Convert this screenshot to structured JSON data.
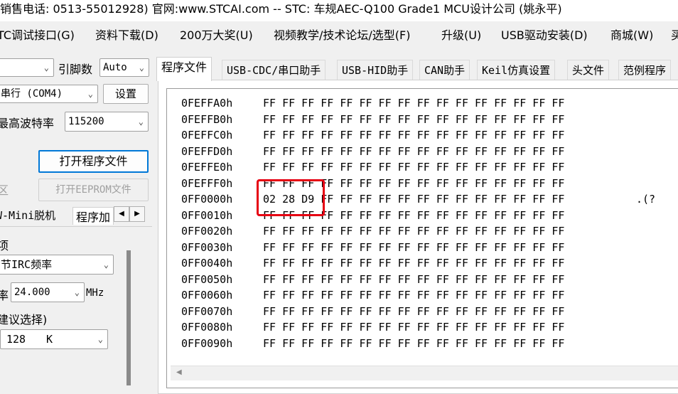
{
  "title_bar": "销售电话: 0513-55012928) 官网:www.STCAI.com  -- STC: 车规AEC-Q100 Grade1 MCU设计公司 (姚永平)",
  "menu": [
    "TC调试接口(G)",
    "资料下载(D)",
    "200万大奖(U)",
    "视频教学/技术论坛/选型(F)",
    "升级(U)",
    "USB驱动安装(D)",
    "商城(W)",
    "买"
  ],
  "left": {
    "mcu_combo": "",
    "pin_label": "引脚数",
    "pin_value": "Auto",
    "port_value": "串行 (COM4)",
    "settings_button": "设置",
    "baud_label": "最高波特率",
    "baud_value": "115200",
    "open_program_button": "打开程序文件",
    "area_label": "区",
    "open_eeprom_button": "打开EEPROM文件",
    "sub_tabs": [
      "W-Mini脱机",
      "程序加"
    ],
    "section_label": "项",
    "irc_label": "节IRC频率",
    "freq_label": "率",
    "freq_value": "24.000",
    "freq_unit": "MHz",
    "suggest_label": "建议选择)",
    "size_value": "128",
    "size_unit": "K"
  },
  "tabs": [
    "程序文件",
    "USB-CDC/串口助手",
    "USB-HID助手",
    "CAN助手",
    "Keil仿真设置",
    "头文件",
    "范例程序"
  ],
  "hex_rows": [
    {
      "addr": "0FEFFA0h",
      "bytes": "FF FF FF FF FF FF FF FF FF FF FF FF FF FF FF FF",
      "ascii": ""
    },
    {
      "addr": "0FEFFB0h",
      "bytes": "FF FF FF FF FF FF FF FF FF FF FF FF FF FF FF FF",
      "ascii": ""
    },
    {
      "addr": "0FEFFC0h",
      "bytes": "FF FF FF FF FF FF FF FF FF FF FF FF FF FF FF FF",
      "ascii": ""
    },
    {
      "addr": "0FEFFD0h",
      "bytes": "FF FF FF FF FF FF FF FF FF FF FF FF FF FF FF FF",
      "ascii": ""
    },
    {
      "addr": "0FEFFE0h",
      "bytes": "FF FF FF FF FF FF FF FF FF FF FF FF FF FF FF FF",
      "ascii": ""
    },
    {
      "addr": "0FEFFF0h",
      "bytes": "FF FF FF FF FF FF FF FF FF FF FF FF FF FF FF FF",
      "ascii": ""
    },
    {
      "addr": "0FF0000h",
      "bytes": "02 28 D9 FF FF FF FF FF FF FF FF FF FF FF FF FF",
      "ascii": ".(?"
    },
    {
      "addr": "0FF0010h",
      "bytes": "FF FF FF FF FF FF FF FF FF FF FF FF FF FF FF FF",
      "ascii": ""
    },
    {
      "addr": "0FF0020h",
      "bytes": "FF FF FF FF FF FF FF FF FF FF FF FF FF FF FF FF",
      "ascii": ""
    },
    {
      "addr": "0FF0030h",
      "bytes": "FF FF FF FF FF FF FF FF FF FF FF FF FF FF FF FF",
      "ascii": ""
    },
    {
      "addr": "0FF0040h",
      "bytes": "FF FF FF FF FF FF FF FF FF FF FF FF FF FF FF FF",
      "ascii": ""
    },
    {
      "addr": "0FF0050h",
      "bytes": "FF FF FF FF FF FF FF FF FF FF FF FF FF FF FF FF",
      "ascii": ""
    },
    {
      "addr": "0FF0060h",
      "bytes": "FF FF FF FF FF FF FF FF FF FF FF FF FF FF FF FF",
      "ascii": ""
    },
    {
      "addr": "0FF0070h",
      "bytes": "FF FF FF FF FF FF FF FF FF FF FF FF FF FF FF FF",
      "ascii": ""
    },
    {
      "addr": "0FF0080h",
      "bytes": "FF FF FF FF FF FF FF FF FF FF FF FF FF FF FF FF",
      "ascii": ""
    },
    {
      "addr": "0FF0090h",
      "bytes": "FF FF FF FF FF FF FF FF FF FF FF FF FF FF FF FF",
      "ascii": ""
    }
  ],
  "colors": {
    "highlight": "#e60012",
    "focus": "#0078d7"
  },
  "icons": [
    "chevron-down-icon",
    "scroll-left-icon",
    "scroll-right-icon"
  ]
}
